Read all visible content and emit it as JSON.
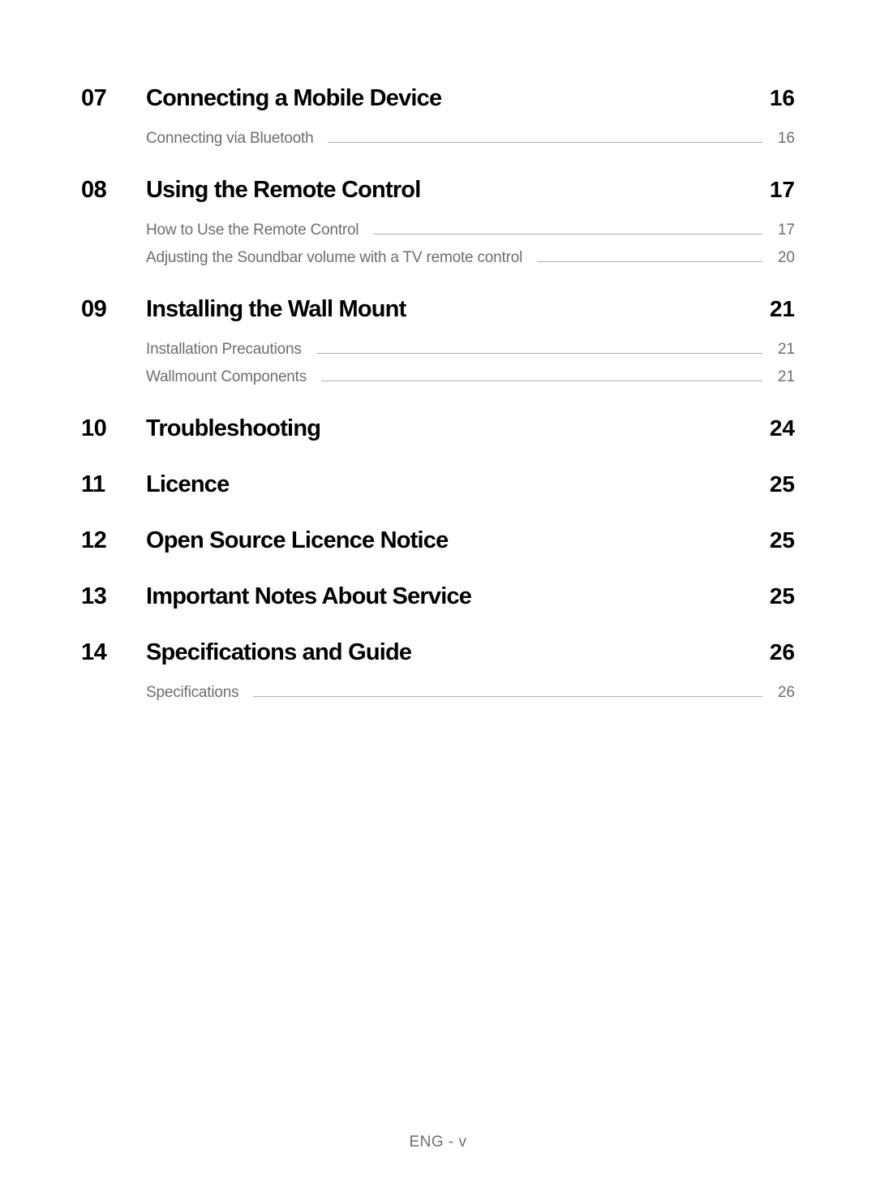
{
  "toc": [
    {
      "number": "07",
      "title": "Connecting a Mobile Device",
      "page": "16",
      "subs": [
        {
          "title": "Connecting via Bluetooth",
          "page": "16"
        }
      ]
    },
    {
      "number": "08",
      "title": "Using the Remote Control",
      "page": "17",
      "subs": [
        {
          "title": "How to Use the Remote Control",
          "page": "17"
        },
        {
          "title": "Adjusting the Soundbar volume with a TV remote control",
          "page": "20"
        }
      ]
    },
    {
      "number": "09",
      "title": "Installing the Wall Mount",
      "page": "21",
      "subs": [
        {
          "title": "Installation Precautions",
          "page": "21"
        },
        {
          "title": "Wallmount Components",
          "page": "21"
        }
      ]
    },
    {
      "number": "10",
      "title": "Troubleshooting",
      "page": "24",
      "subs": []
    },
    {
      "number": "11",
      "title": "Licence",
      "page": "25",
      "subs": []
    },
    {
      "number": "12",
      "title": "Open Source Licence Notice",
      "page": "25",
      "subs": []
    },
    {
      "number": "13",
      "title": "Important Notes About Service",
      "page": "25",
      "subs": []
    },
    {
      "number": "14",
      "title": "Specifications and Guide",
      "page": "26",
      "subs": [
        {
          "title": "Specifications",
          "page": "26"
        }
      ]
    }
  ],
  "footer": "ENG - v"
}
